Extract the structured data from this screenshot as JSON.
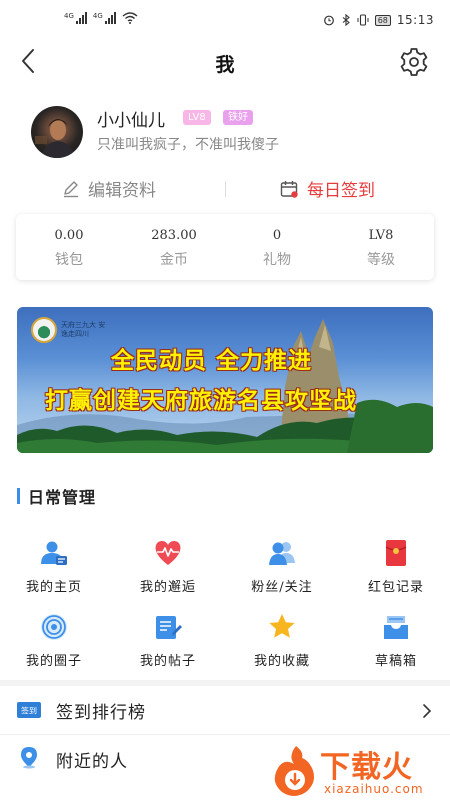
{
  "status_bar": {
    "time": "15:13",
    "battery": "68",
    "signal_tag_1": "4G",
    "signal_tag_2": "4G"
  },
  "header": {
    "title": "我",
    "back_icon": "chevron-left-icon",
    "settings_icon": "gear-icon"
  },
  "profile": {
    "username": "小小仙儿",
    "level_badge": "LV8",
    "tag_badge": "铁好",
    "signature": "只准叫我疯子，不准叫我傻子"
  },
  "actions": {
    "edit_label": "编辑资料",
    "checkin_label": "每日签到"
  },
  "stats": [
    {
      "value": "0.00",
      "label": "钱包"
    },
    {
      "value": "283.00",
      "label": "金币"
    },
    {
      "value": "0",
      "label": "礼物"
    },
    {
      "value": "LV8",
      "label": "等级"
    }
  ],
  "banner": {
    "logo_text": "天府三九大 安逸走四川",
    "line1": "全民动员 全力推进",
    "line2": "打赢创建天府旅游名县攻坚战"
  },
  "section": {
    "title": "日常管理"
  },
  "grid": [
    {
      "label": "我的主页",
      "icon": "profile-card-icon"
    },
    {
      "label": "我的邂逅",
      "icon": "heartbeat-icon"
    },
    {
      "label": "粉丝/关注",
      "icon": "fans-icon"
    },
    {
      "label": "红包记录",
      "icon": "red-envelope-icon"
    },
    {
      "label": "我的圈子",
      "icon": "target-circle-icon"
    },
    {
      "label": "我的帖子",
      "icon": "post-edit-icon"
    },
    {
      "label": "我的收藏",
      "icon": "star-icon"
    },
    {
      "label": "草稿箱",
      "icon": "draft-box-icon"
    }
  ],
  "list": [
    {
      "label": "签到排行榜",
      "icon_text": "签到",
      "icon": "checkin-rank-icon"
    },
    {
      "label": "附近的人",
      "icon": "location-pin-icon"
    }
  ],
  "watermark": {
    "big": "下载火",
    "small": "xiazaihuo.com"
  },
  "colors": {
    "accent_blue": "#3b8fe6",
    "checkin_red": "#e63c3c",
    "badge_pink": "#f8b6e6",
    "watermark_orange": "#f26522"
  }
}
